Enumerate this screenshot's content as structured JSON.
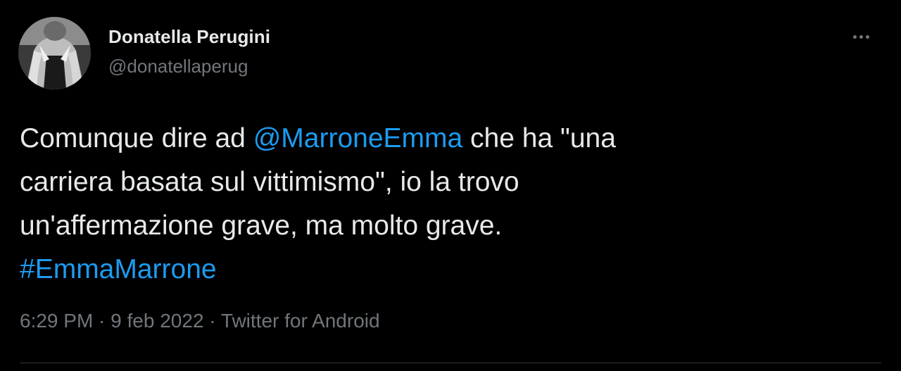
{
  "author": {
    "display_name": "Donatella Perugini",
    "handle": "@donatellaperug"
  },
  "menu": {
    "icon": "more-horizontal-icon"
  },
  "tweet": {
    "line1_pre": "Comunque dire ad ",
    "mention": "@MarroneEmma",
    "line1_post": " che  ha \"una",
    "line2": "carriera basata sul vittimismo\", io la trovo",
    "line3": "un'affermazione grave, ma molto grave.",
    "hashtag": "#EmmaMarrone"
  },
  "meta": {
    "time": "6:29 PM",
    "sep1": " · ",
    "date": "9 feb 2022",
    "sep2": " · ",
    "source": "Twitter for Android"
  },
  "colors": {
    "background": "#000000",
    "text": "#e7e9ea",
    "secondary": "#71767b",
    "link": "#1d9bf0",
    "divider": "#2f3336"
  }
}
